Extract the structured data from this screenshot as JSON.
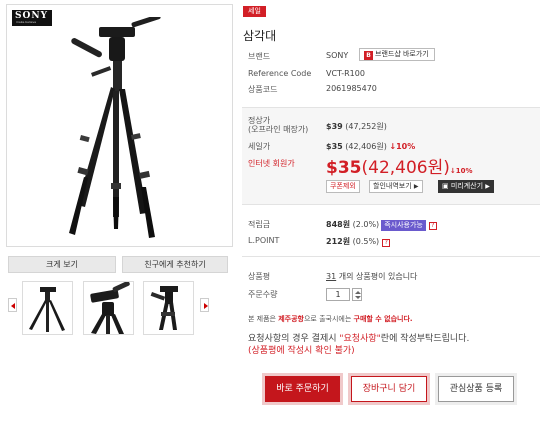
{
  "gallery": {
    "brand_logo_text": "SONY",
    "brand_logo_tagline": "make.believe",
    "zoom_button": "크게 보기",
    "recommend_button": "친구에게 추천하기"
  },
  "product": {
    "sale_badge": "세일",
    "title": "삼각대",
    "brand_label": "브랜드",
    "brand_value": "SONY",
    "brand_shop_icon": "B",
    "brand_shop_button": "브랜드샵 바로가기",
    "reference_label": "Reference Code",
    "reference_value": "VCT-R100",
    "code_label": "상품코드",
    "code_value": "2061985470"
  },
  "price": {
    "regular_label_1": "정상가",
    "regular_label_2": "(오프라인 매장가)",
    "regular_value": "$39",
    "regular_won": "(47,252원)",
    "sale_label": "세일가",
    "sale_value": "$35",
    "sale_won": "(42,406원)",
    "sale_discount": "↓10%",
    "internet_label": "인터넷 회원가",
    "internet_value": "$35",
    "internet_won": "(42,406원)",
    "internet_discount": "↓10%",
    "coupon_button": "쿠폰제외",
    "discount_detail_button": "할인내역보기",
    "calc_button": "미리계산기"
  },
  "points": {
    "reserve_label": "적립금",
    "reserve_value": "848원",
    "reserve_rate": "(2.0%)",
    "instant_use_button": "즉시사용가능",
    "lpoint_label": "L.POINT",
    "lpoint_value": "212원",
    "lpoint_rate": "(0.5%)",
    "help_icon": "?"
  },
  "review": {
    "label": "상품평",
    "count": "31",
    "text": "개의 상품평이 있습니다"
  },
  "order": {
    "qty_label": "주문수량",
    "qty_value": "1"
  },
  "notice": {
    "prefix": "본 제품은 ",
    "bold1": "제주공항",
    "middle": "으로 출국시에는 ",
    "bold2": "구매할 수 없습니다."
  },
  "request": {
    "text_a": "요청사항의 경우 결제시 ",
    "text_hl": "\"요청사항\"",
    "text_b": "란에 작성부탁드립니다.",
    "warn": "(상품평에 작성시 확인 불가)"
  },
  "actions": {
    "buy_now": "바로 주문하기",
    "add_cart": "장바구니 담기",
    "wish": "관심상품 등록"
  },
  "colors": {
    "accent_red": "#d21f26",
    "point_purple": "#6a5acd"
  }
}
